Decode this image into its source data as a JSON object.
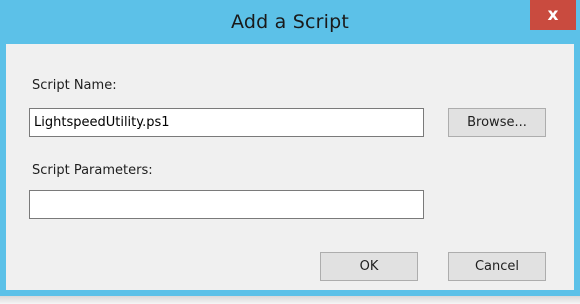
{
  "dialog": {
    "title": "Add a Script",
    "close_glyph": "x",
    "close_icon": "close-icon"
  },
  "script_name": {
    "label": "Script Name:",
    "value": "LightspeedUtility.ps1"
  },
  "browse_button": {
    "label": "Browse..."
  },
  "script_parameters": {
    "label": "Script Parameters:",
    "value": ""
  },
  "buttons": {
    "ok": "OK",
    "cancel": "Cancel"
  },
  "colors": {
    "titlebar": "#5cc1e8",
    "client": "#f0f0f0",
    "close_button": "#c94b3f"
  }
}
